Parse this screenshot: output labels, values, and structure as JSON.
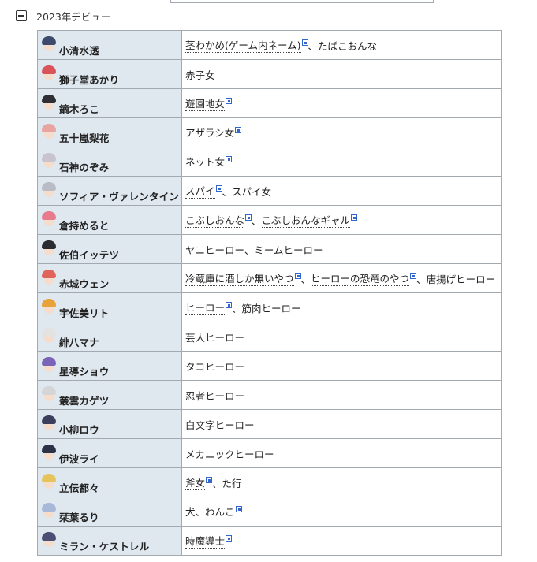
{
  "section": {
    "title": "2023年デビュー"
  },
  "rows": [
    {
      "name": "小清水透",
      "hair": "#3d4a6b",
      "nicknames": [
        {
          "text": "茎わかめ(ゲーム内ネーム)",
          "link": true
        },
        {
          "text": "たばこおんな",
          "link": false
        }
      ]
    },
    {
      "name": "獅子堂あかり",
      "hair": "#d9535a",
      "nicknames": [
        {
          "text": "赤子女",
          "link": false
        }
      ]
    },
    {
      "name": "鏑木ろこ",
      "hair": "#2e2e34",
      "nicknames": [
        {
          "text": "遊園地女",
          "link": true
        }
      ]
    },
    {
      "name": "五十嵐梨花",
      "hair": "#e8a4a0",
      "nicknames": [
        {
          "text": "アザラシ女",
          "link": true
        }
      ]
    },
    {
      "name": "石神のぞみ",
      "hair": "#c9c3cf",
      "nicknames": [
        {
          "text": "ネット女",
          "link": true
        }
      ]
    },
    {
      "name": "ソフィア・ヴァレンタイン",
      "hair": "#b9bcc4",
      "nicknames": [
        {
          "text": "スパイ",
          "link": true
        },
        {
          "text": "スパイ女",
          "link": false
        }
      ]
    },
    {
      "name": "倉持めると",
      "hair": "#e87a8e",
      "nicknames": [
        {
          "text": "こぶしおんな",
          "link": true
        },
        {
          "text": "こぶしおんなギャル",
          "link": true
        }
      ]
    },
    {
      "name": "佐伯イッテツ",
      "hair": "#2b2b33",
      "nicknames": [
        {
          "text": "ヤニヒーロー、ミームヒーロー",
          "link": false
        }
      ]
    },
    {
      "name": "赤城ウェン",
      "hair": "#e0645c",
      "nicknames": [
        {
          "text": "冷蔵庫に酒しか無いやつ",
          "link": true
        },
        {
          "text": "ヒーローの恐竜のやつ",
          "link": true
        },
        {
          "text": "唐揚げヒーロー",
          "link": false
        }
      ]
    },
    {
      "name": "宇佐美リト",
      "hair": "#e8a23a",
      "nicknames": [
        {
          "text": "ヒーロー",
          "link": true
        },
        {
          "text": "筋肉ヒーロー",
          "link": false
        }
      ]
    },
    {
      "name": "緋八マナ",
      "hair": "#e4e2de",
      "nicknames": [
        {
          "text": "芸人ヒーロー",
          "link": false
        }
      ]
    },
    {
      "name": "星導ショウ",
      "hair": "#7a64b8",
      "nicknames": [
        {
          "text": "タコヒーロー",
          "link": false
        }
      ]
    },
    {
      "name": "叢雲カゲツ",
      "hair": "#d5d5d8",
      "nicknames": [
        {
          "text": "忍者ヒーロー",
          "link": false
        }
      ]
    },
    {
      "name": "小柳ロウ",
      "hair": "#3b3f5c",
      "nicknames": [
        {
          "text": "白文字ヒーロー",
          "link": false
        }
      ]
    },
    {
      "name": "伊波ライ",
      "hair": "#2c3147",
      "nicknames": [
        {
          "text": "メカニックヒーロー",
          "link": false
        }
      ]
    },
    {
      "name": "立伝都々",
      "hair": "#e5c45c",
      "nicknames": [
        {
          "text": "斧女",
          "link": true
        },
        {
          "text": "た行",
          "link": false
        }
      ]
    },
    {
      "name": "栞葉るり",
      "hair": "#a7b8d8",
      "nicknames": [
        {
          "text": "犬、わんこ",
          "link": true
        }
      ]
    },
    {
      "name": "ミラン・ケストレル",
      "hair": "#4a4f73",
      "nicknames": [
        {
          "text": "時魔導士",
          "link": true
        }
      ]
    }
  ]
}
